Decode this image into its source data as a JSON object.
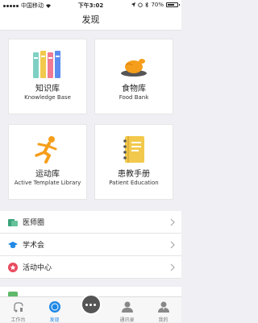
{
  "status_bar": {
    "carrier": "中国移动",
    "time": "下午3:02",
    "battery": "70%",
    "battery_level": 0.7
  },
  "nav": {
    "title": "发现"
  },
  "cards": [
    {
      "title": "知识库",
      "subtitle": "Knowledge Base",
      "icon": "books-icon"
    },
    {
      "title": "食物库",
      "subtitle": "Food Bank",
      "icon": "roast-chicken-icon"
    },
    {
      "title": "运动库",
      "subtitle": "Active Template Library",
      "icon": "runner-icon"
    },
    {
      "title": "患教手册",
      "subtitle": "Patient Education",
      "icon": "notebook-icon"
    }
  ],
  "list": [
    {
      "label": "医师圈",
      "icon": "doctor-circle-icon",
      "color": "#3aa37a"
    },
    {
      "label": "学术会",
      "icon": "graduation-cap-icon",
      "color": "#1e88e5"
    },
    {
      "label": "活动中心",
      "icon": "star-badge-icon",
      "color": "#e84a5f"
    }
  ],
  "tabs": [
    {
      "label": "工作台",
      "icon": "workbench-icon"
    },
    {
      "label": "发现",
      "icon": "discover-icon",
      "active": true
    },
    {
      "label": "",
      "icon": "chat-bubble-icon"
    },
    {
      "label": "通讯录",
      "icon": "contacts-icon"
    },
    {
      "label": "我的",
      "icon": "profile-icon"
    }
  ],
  "colors": {
    "accent": "#1e88e5",
    "background": "#efeff4"
  }
}
